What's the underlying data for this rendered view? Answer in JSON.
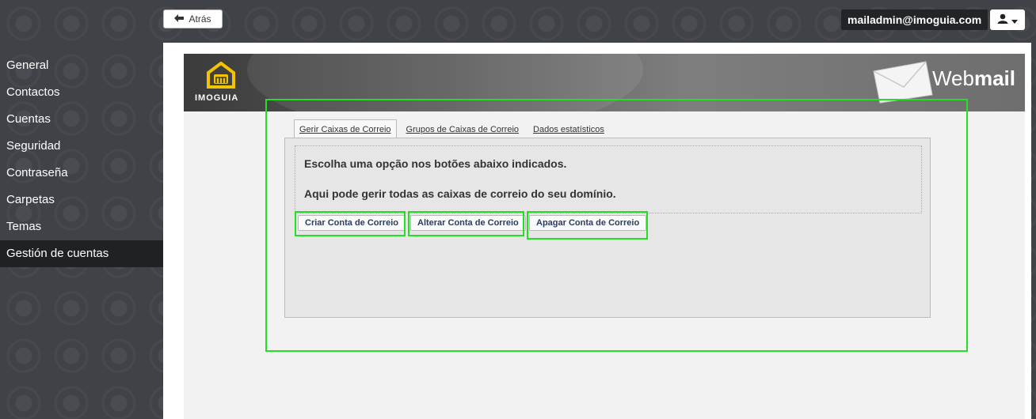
{
  "topbar": {
    "back_label": "Atrás",
    "user_email": "mailadmin@imoguia.com"
  },
  "sidebar": {
    "items": [
      {
        "label": "General"
      },
      {
        "label": "Contactos"
      },
      {
        "label": "Cuentas"
      },
      {
        "label": "Seguridad"
      },
      {
        "label": "Contraseña"
      },
      {
        "label": "Carpetas"
      },
      {
        "label": "Temas"
      },
      {
        "label": "Gestión de cuentas",
        "active": true
      }
    ]
  },
  "banner": {
    "logo_text": "IMOGUIA",
    "title_light": "Web",
    "title_bold": "mail"
  },
  "tabs": [
    {
      "label": "Gerir Caixas de Correio",
      "active": true
    },
    {
      "label": "Grupos de Caixas de Correio"
    },
    {
      "label": "Dados estatísticos"
    }
  ],
  "content": {
    "line1": "Escolha uma opção nos botões abaixo indicados.",
    "line2": "Aqui pode gerir todas as caixas de correio do seu domínio."
  },
  "actions": {
    "create": "Criar Conta de Correio",
    "edit": "Alterar Conta de Correio",
    "delete": "Apagar Conta de Correio"
  },
  "colors": {
    "highlight": "#22e022",
    "sidebar_active": "#1f2124"
  }
}
